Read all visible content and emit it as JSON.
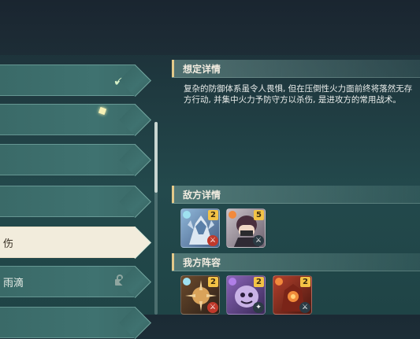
{
  "list": {
    "items": [
      {
        "label": "",
        "state": "completed"
      },
      {
        "label": "",
        "state": "normal"
      },
      {
        "label": "",
        "state": "normal"
      },
      {
        "label": "",
        "state": "normal"
      },
      {
        "label": "伤",
        "state": "selected"
      },
      {
        "label": "雨滴",
        "state": "locked"
      },
      {
        "label": "",
        "state": "normal"
      }
    ]
  },
  "panel": {
    "scenario_title": "想定详情",
    "scenario_desc_line1": "复杂的防御体系虽令人畏惧, 但在压倒性火力面前终将落然无存",
    "scenario_desc_line2": "方行动, 并集中火力予防守方以杀伤, 是进攻方的常用战术。",
    "enemy_title": "敌方详情",
    "ally_title": "我方阵容"
  },
  "enemy_units": [
    {
      "level": "2",
      "element": "cryo",
      "weapon": "sword-icon"
    },
    {
      "level": "5",
      "element": "pyro",
      "weapon": "sword-icon"
    }
  ],
  "ally_units": [
    {
      "level": "2",
      "element": "cryo",
      "weapon": "sword-icon"
    },
    {
      "level": "2",
      "element": "electro",
      "weapon": "catalyst-icon"
    },
    {
      "level": "2",
      "element": "pyro",
      "weapon": "sword-icon"
    }
  ],
  "colors": {
    "accent": "#e3c98a",
    "level_badge": "#f3c346",
    "selected_item": "#f2ecdc"
  }
}
